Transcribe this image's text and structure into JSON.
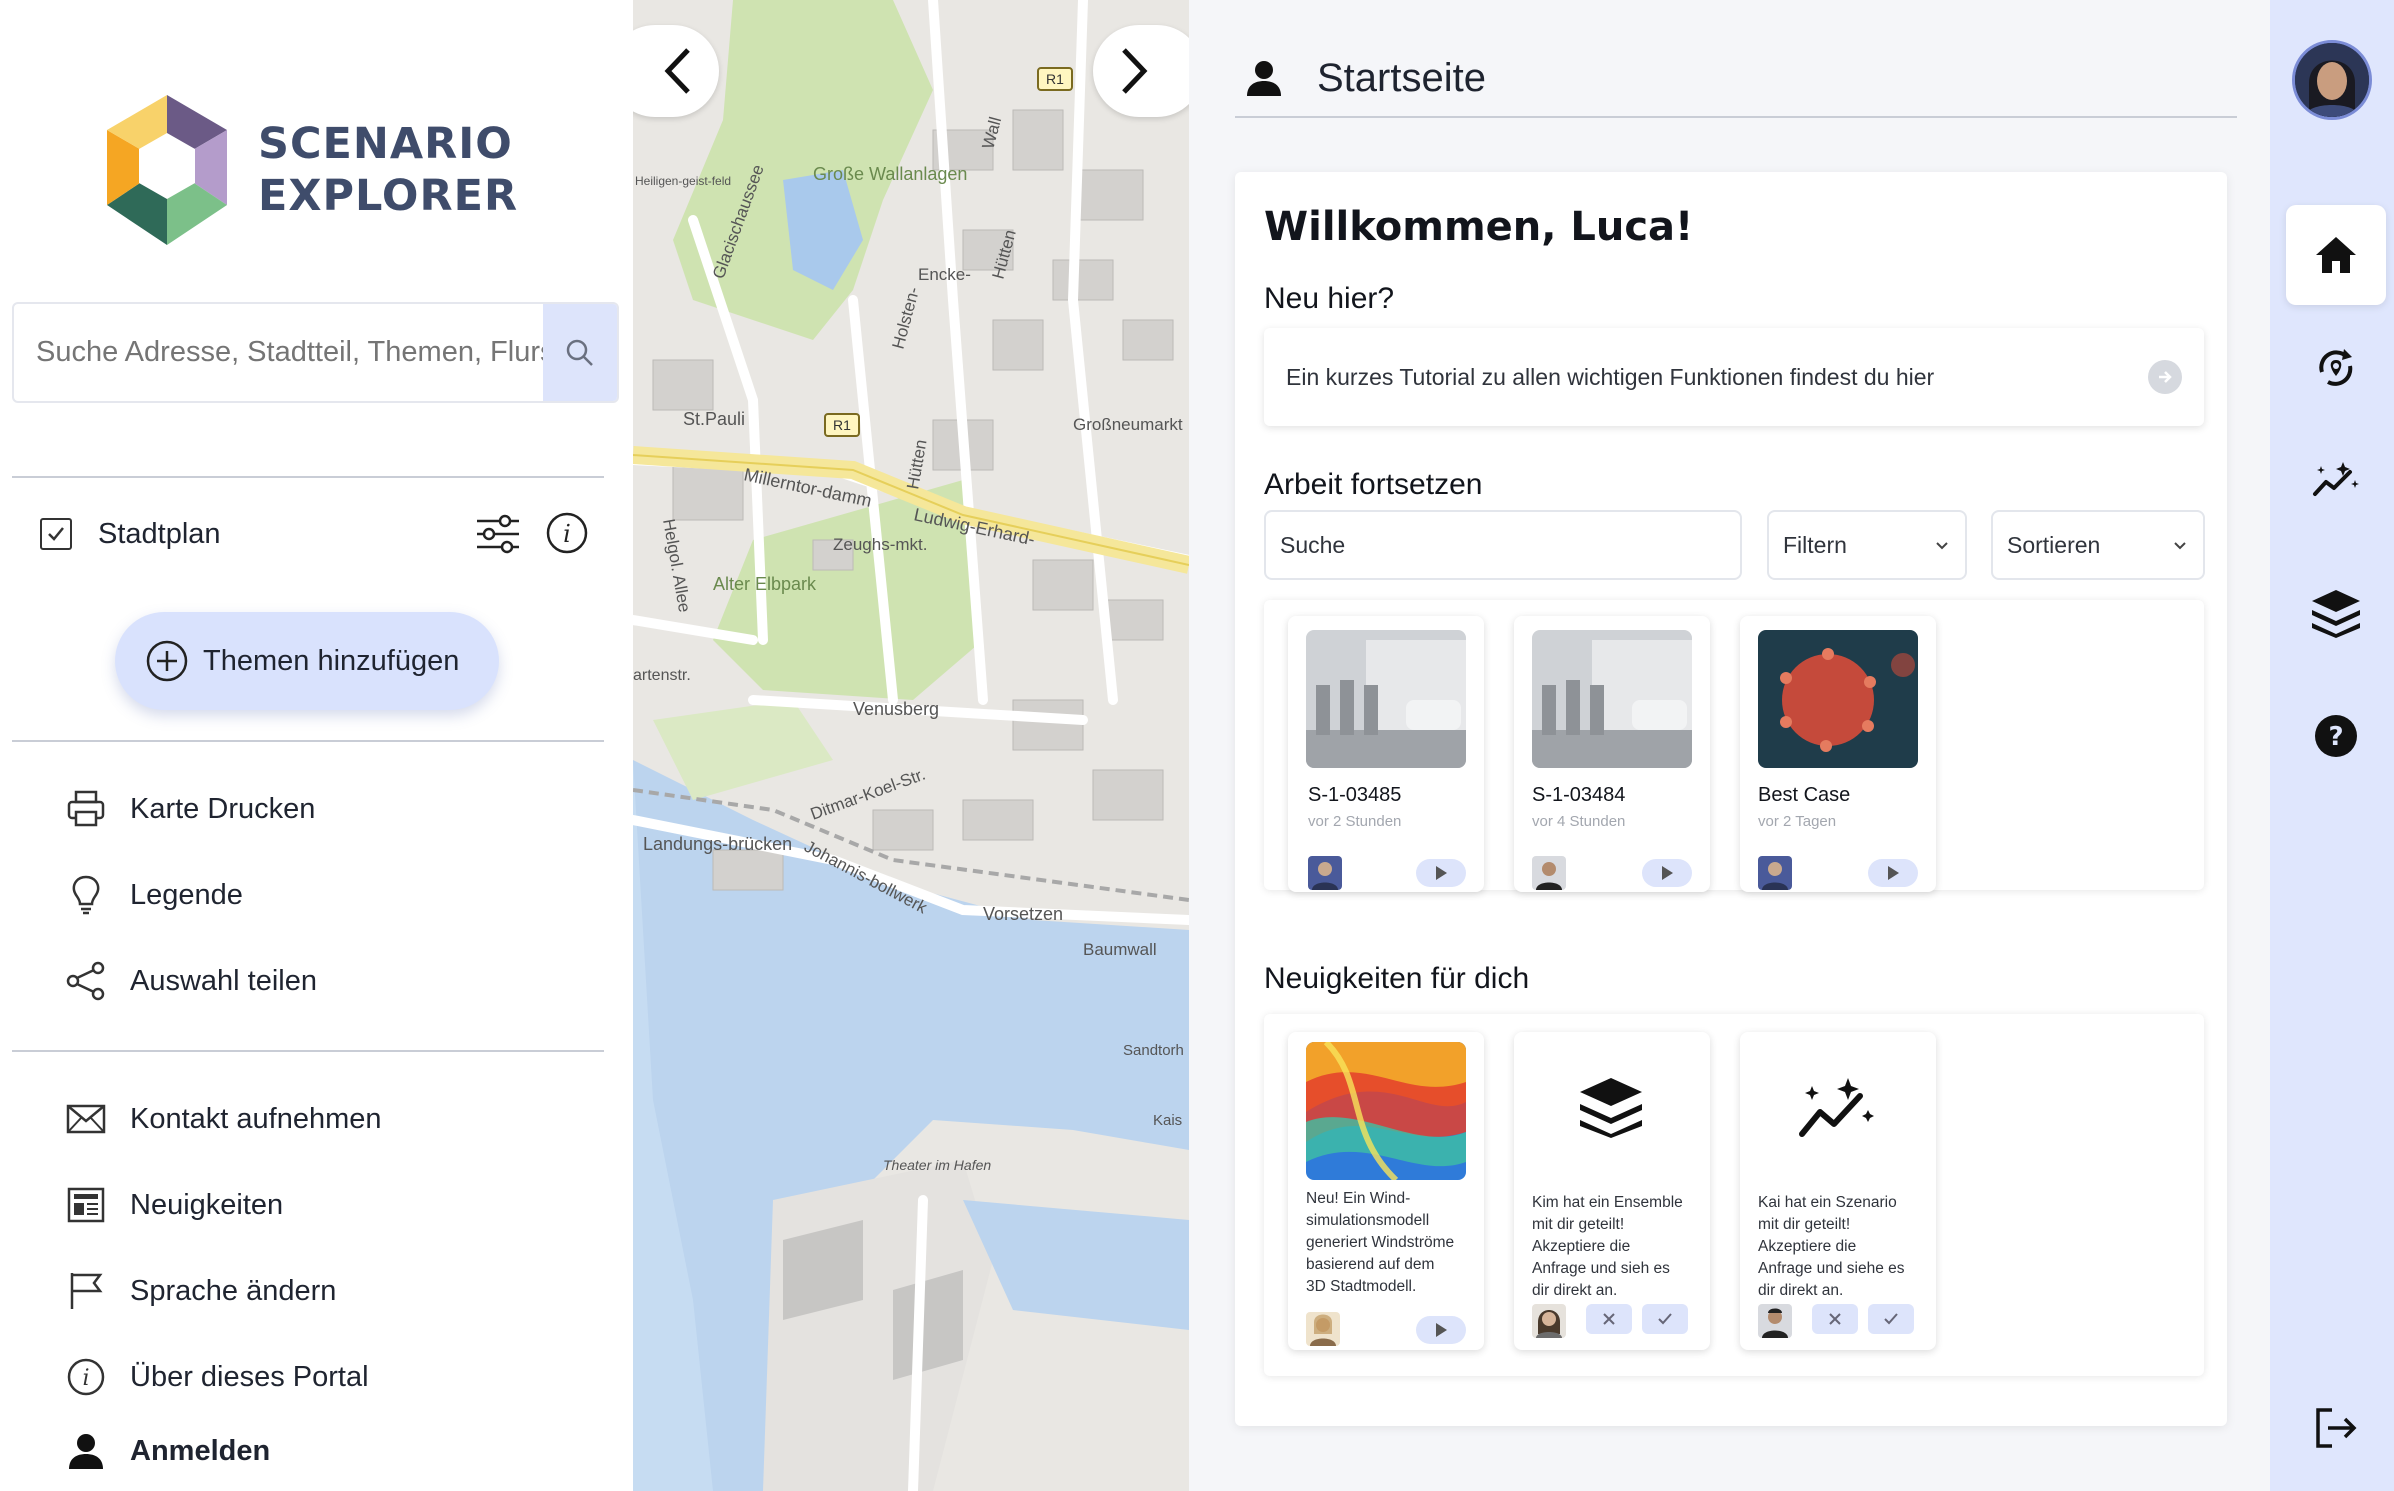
{
  "sidebar": {
    "logo_text_line1": "SCENARIO",
    "logo_text_line2": "EXPLORER",
    "search_placeholder": "Suche Adresse, Stadtteil, Themen, Flurs",
    "layer": {
      "label": "Stadtplan",
      "checked": true
    },
    "add_topics_label": "Themen hinzufügen",
    "tools": [
      {
        "label": "Karte Drucken",
        "icon": "printer-icon"
      },
      {
        "label": "Legende",
        "icon": "lightbulb-icon"
      },
      {
        "label": "Auswahl teilen",
        "icon": "share-icon"
      }
    ],
    "links": [
      {
        "label": "Kontakt aufnehmen",
        "icon": "mail-icon"
      },
      {
        "label": "Neuigkeiten",
        "icon": "newspaper-icon"
      },
      {
        "label": "Sprache ändern",
        "icon": "flag-icon"
      },
      {
        "label": "Über dieses Portal",
        "icon": "info-icon"
      },
      {
        "label": "Anmelden",
        "icon": "user-icon"
      }
    ]
  },
  "map": {
    "labels": [
      "Große Wallanlagen",
      "St.Pauli",
      "Millerntor-damm",
      "Ludwig-Erhard-",
      "Zeughs-mkt.",
      "Alter Elbpark",
      "Venusberg",
      "Ditmar-Koel-Str.",
      "Johannis-bollwerk",
      "Landungs-brücken",
      "Vorsetzen",
      "Baumwall",
      "Großneumarkt",
      "Sandtorh",
      "Theater im Hafen",
      "Glacischaussee",
      "Holsten-",
      "Hütten",
      "Helgol. Allee",
      "Encke-",
      "Wall",
      "Hütten",
      "Heiligen-geist-feld",
      "Kais",
      "artenstr."
    ],
    "route_badges": [
      "R1",
      "R1"
    ]
  },
  "main": {
    "header_title": "Startseite",
    "welcome": "Willkommen, Luca!",
    "new_here": "Neu hier?",
    "tutorial_text": "Ein kurzes Tutorial zu allen wichtigen Funktionen findest du hier",
    "continue_title": "Arbeit fortsetzen",
    "search_placeholder": "Suche",
    "filter_label": "Filtern",
    "sort_label": "Sortieren",
    "work_cards": [
      {
        "title": "S-1-03485",
        "subtitle": "vor 2 Stunden"
      },
      {
        "title": "S-1-03484",
        "subtitle": "vor 4 Stunden"
      },
      {
        "title": "Best Case",
        "subtitle": "vor 2 Tagen"
      }
    ],
    "news_title": "Neuigkeiten für dich",
    "news_cards": [
      {
        "lines": [
          "Neu! Ein Wind-",
          "simulationsmodell",
          "generiert Windströme",
          "basierend auf dem",
          "3D Stadtmodell."
        ]
      },
      {
        "lines": [
          "Kim hat ein Ensemble",
          "mit dir geteilt!",
          "Akzeptiere die",
          "Anfrage und sieh es",
          "dir direkt an."
        ]
      },
      {
        "lines": [
          "Kai hat ein Szenario",
          "mit dir geteilt!",
          "Akzeptiere die",
          "Anfrage und siehe es",
          "dir direkt an."
        ]
      }
    ]
  },
  "rightnav": {
    "items": [
      "home-icon",
      "rotate-icon",
      "analytics-icon",
      "layers-icon",
      "help-icon"
    ],
    "logout": "logout-icon"
  },
  "colors": {
    "accent": "#dde4fb",
    "rightnav_bg": "#dfe6fd",
    "logo_text": "#3f4c6b"
  }
}
